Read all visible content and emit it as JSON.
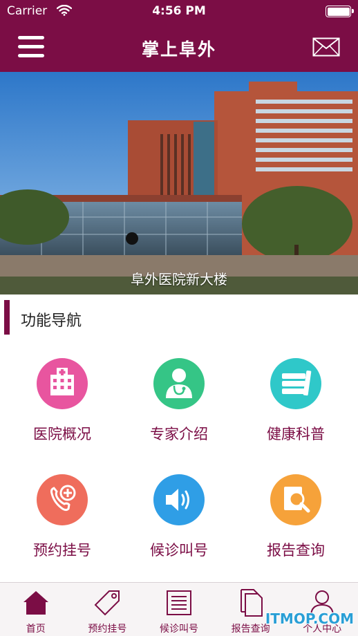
{
  "status_bar": {
    "carrier": "Carrier",
    "time": "4:56 PM",
    "battery_level": 1.0
  },
  "nav": {
    "title": "掌上阜外",
    "menu_icon": "hamburger-menu-icon",
    "mail_icon": "envelope-icon"
  },
  "banner": {
    "caption": "阜外医院新大楼",
    "active_slide": 1
  },
  "section": {
    "title": "功能导航"
  },
  "features": [
    {
      "label": "医院概况",
      "icon": "hospital-icon",
      "color": "#e8559f"
    },
    {
      "label": "专家介绍",
      "icon": "doctor-icon",
      "color": "#35c586"
    },
    {
      "label": "健康科普",
      "icon": "books-icon",
      "color": "#2fc8c9"
    },
    {
      "label": "预约挂号",
      "icon": "phone-plus-icon",
      "color": "#ef6d5c"
    },
    {
      "label": "候诊叫号",
      "icon": "speaker-icon",
      "color": "#2f9ee6"
    },
    {
      "label": "报告查询",
      "icon": "report-search-icon",
      "color": "#f6a23a"
    }
  ],
  "tabs": [
    {
      "label": "首页",
      "icon": "home-icon",
      "active": true
    },
    {
      "label": "预约挂号",
      "icon": "tag-icon",
      "active": false
    },
    {
      "label": "候诊叫号",
      "icon": "list-icon",
      "active": false
    },
    {
      "label": "报告查询",
      "icon": "document-icon",
      "active": false
    },
    {
      "label": "个人中心",
      "icon": "person-icon",
      "active": false
    }
  ],
  "colors": {
    "brand": "#7b0d45",
    "tabbar_bg": "#f7f4f5"
  },
  "watermark": "ITMOP.COM"
}
